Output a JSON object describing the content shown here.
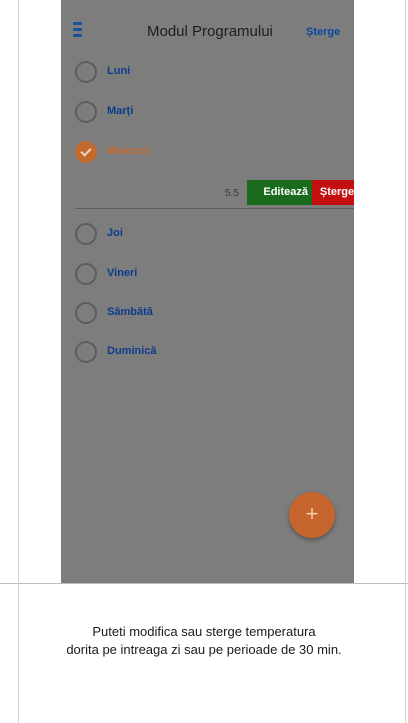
{
  "header": {
    "title": "Modul Programului",
    "delete_label": "Șterge"
  },
  "days": [
    {
      "label": "Luni",
      "checked": false
    },
    {
      "label": "Marți",
      "checked": false
    },
    {
      "label": "Miercuri",
      "checked": true
    },
    {
      "label": "Joi",
      "checked": false
    },
    {
      "label": "Vineri",
      "checked": false
    },
    {
      "label": "Sâmbătă",
      "checked": false
    },
    {
      "label": "Duminică",
      "checked": false
    }
  ],
  "slot": {
    "value": "5.5",
    "edit_label": "Editează",
    "delete_label": "Șterge"
  },
  "fab": {
    "label": "+"
  },
  "caption": {
    "line1": "Puteti modifica sau sterge temperatura",
    "line2": "dorita pe intreaga zi sau pe perioade de 30 min."
  },
  "colors": {
    "overlay": "#7d7d7d",
    "accent_orange": "#c5652d",
    "label_blue": "#0d3b8c",
    "edit_green": "#1b6b1f",
    "delete_red": "#c30f0f"
  }
}
